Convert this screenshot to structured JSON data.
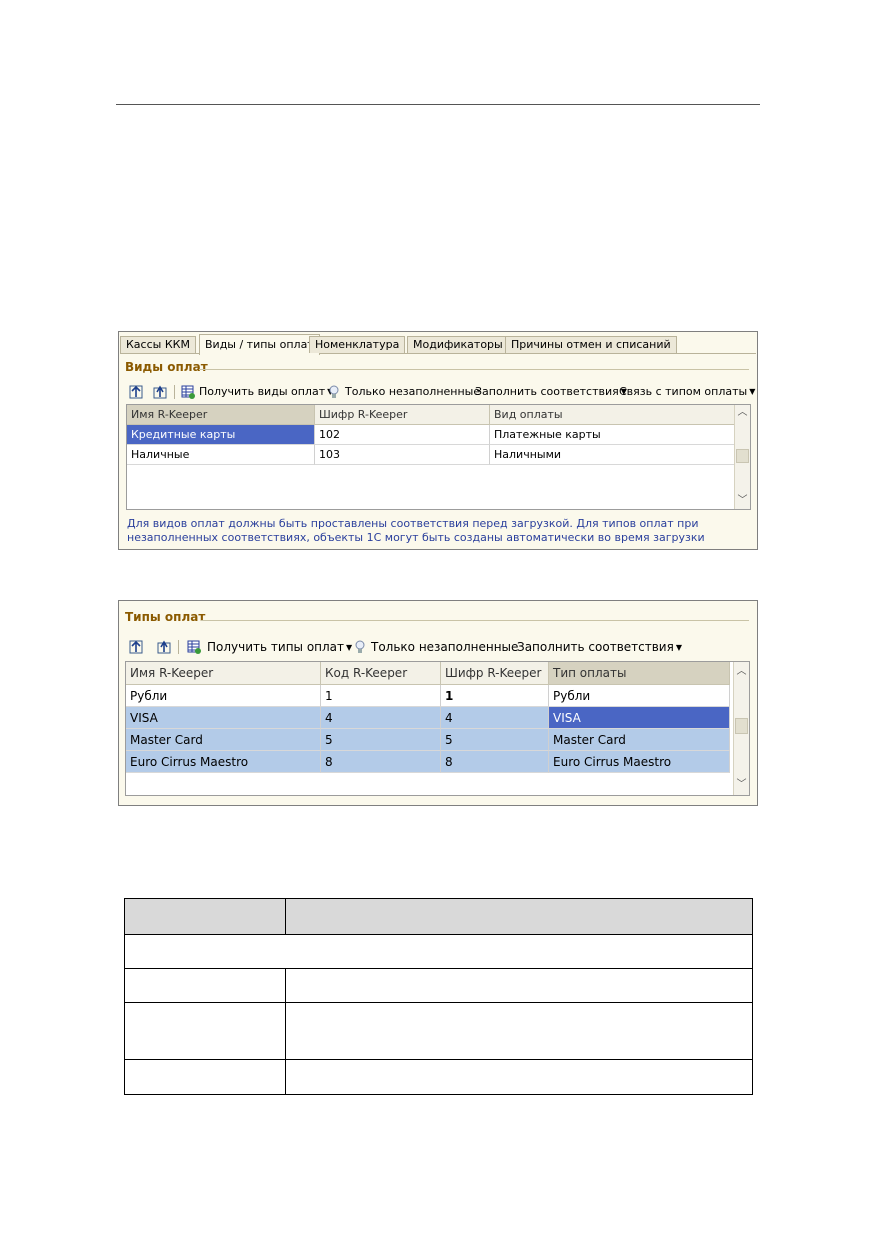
{
  "window1": {
    "tabs": [
      "Кассы ККМ",
      "Виды / типы оплат",
      "Номенклатура",
      "Модификаторы",
      "Причины отмен и списаний"
    ],
    "group_title": "Виды оплат",
    "toolbar": {
      "get_label": "Получить виды оплат",
      "only_empty_label": "Только незаполненные",
      "fill_label": "Заполнить соответствия",
      "link_label": "Связь с типом оплаты"
    },
    "columns": [
      "Имя R-Keeper",
      "Шифр R-Keeper",
      "Вид оплаты"
    ],
    "rows": [
      {
        "name": "Кредитные карты",
        "code": "102",
        "type": "Платежные карты"
      },
      {
        "name": "Наличные",
        "code": "103",
        "type": "Наличными"
      }
    ],
    "hint": "Для видов оплат должны быть проставлены соответствия перед загрузкой. Для типов оплат при незаполненных соответствиях, объекты 1С могут быть созданы автоматически во время загрузки"
  },
  "window2": {
    "group_title": "Типы оплат",
    "toolbar": {
      "get_label": "Получить типы оплат",
      "only_empty_label": "Только незаполненные",
      "fill_label": "Заполнить соответствия"
    },
    "columns": [
      "Имя R-Keeper",
      "Код R-Keeper",
      "Шифр R-Keeper",
      "Тип оплаты"
    ],
    "rows": [
      {
        "name": "Рубли",
        "kod": "1",
        "code": "1",
        "type": "Рубли"
      },
      {
        "name": "VISA",
        "kod": "4",
        "code": "4",
        "type": "VISA"
      },
      {
        "name": "Master Card",
        "kod": "5",
        "code": "5",
        "type": "Master Card"
      },
      {
        "name": "Euro Cirrus Maestro",
        "kod": "8",
        "code": "8",
        "type": "Euro Cirrus Maestro"
      }
    ]
  },
  "icons": {
    "move_up": "arrow-up-left-icon",
    "move_down": "arrow-up-icon",
    "get": "grid-refresh-icon",
    "bulb": "light-bulb-icon",
    "dropdown": "triangle-down"
  },
  "colors": {
    "selected_cell": "#4a66c4",
    "highlight_row": "#b3cbe8",
    "group_title": "#8b5a00",
    "hint_text": "#2a3f9c",
    "panel_bg": "#fbf9ec"
  }
}
